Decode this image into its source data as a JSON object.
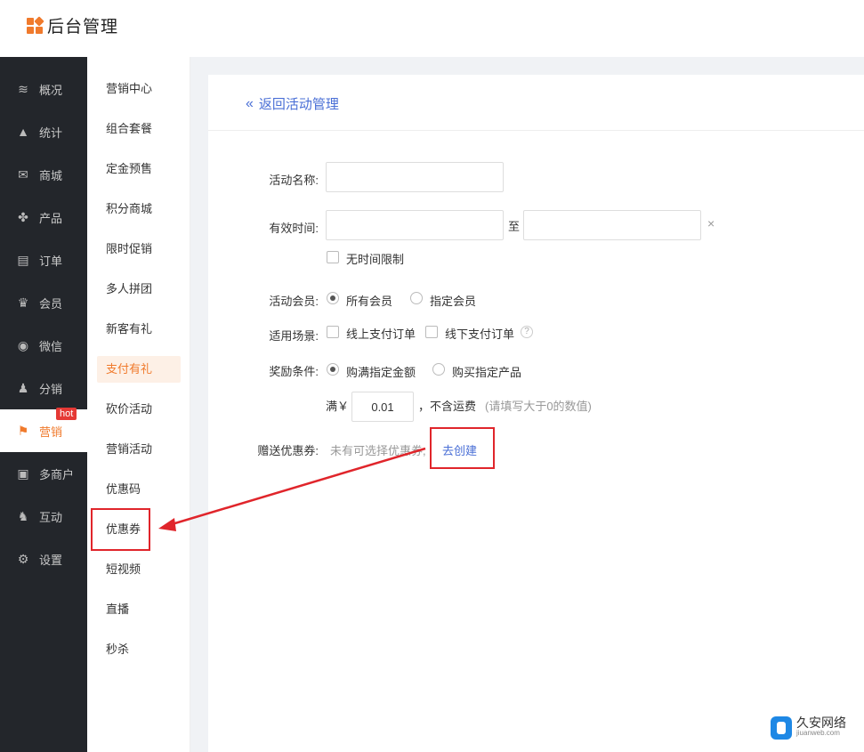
{
  "header": {
    "title": "后台管理"
  },
  "sidebar": {
    "items": [
      {
        "label": "概况",
        "icon": "layers-icon",
        "glyph": "≋"
      },
      {
        "label": "统计",
        "icon": "chart-icon",
        "glyph": "▲"
      },
      {
        "label": "商城",
        "icon": "mail-icon",
        "glyph": "✉"
      },
      {
        "label": "产品",
        "icon": "grid-icon",
        "glyph": "✤"
      },
      {
        "label": "订单",
        "icon": "clipboard-icon",
        "glyph": "▤"
      },
      {
        "label": "会员",
        "icon": "crown-icon",
        "glyph": "♛"
      },
      {
        "label": "微信",
        "icon": "wechat-icon",
        "glyph": "◉"
      },
      {
        "label": "分销",
        "icon": "users-icon",
        "glyph": "♟"
      },
      {
        "label": "营销",
        "icon": "flag-icon",
        "glyph": "⚑",
        "badge": "hot"
      },
      {
        "label": "多商户",
        "icon": "shop-icon",
        "glyph": "▣"
      },
      {
        "label": "互动",
        "icon": "people-icon",
        "glyph": "♞"
      },
      {
        "label": "设置",
        "icon": "gear-icon",
        "glyph": "⚙"
      }
    ]
  },
  "submenu": {
    "items": [
      "营销中心",
      "组合套餐",
      "定金预售",
      "积分商城",
      "限时促销",
      "多人拼团",
      "新客有礼",
      "支付有礼",
      "砍价活动",
      "营销活动",
      "优惠码",
      "优惠券",
      "短视频",
      "直播",
      "秒杀"
    ],
    "active": "支付有礼"
  },
  "main": {
    "back_label": "返回活动管理",
    "form": {
      "name_label": "活动名称:",
      "name_value": "",
      "time_label": "有效时间:",
      "time_sep": "至",
      "time_clear": "×",
      "no_limit_label": "无时间限制",
      "member_label": "活动会员:",
      "member_all": "所有会员",
      "member_specific": "指定会员",
      "scene_label": "适用场景:",
      "scene_online": "线上支付订单",
      "scene_offline": "线下支付订单",
      "scene_help": "?",
      "reward_label": "奖励条件:",
      "reward_amount": "购满指定金额",
      "reward_product": "购买指定产品",
      "full_prefix": "满￥",
      "full_value": "0.01",
      "full_suffix": "，不含运费",
      "full_hint": "(请填写大于0的数值)",
      "coupon_label": "赠送优惠券:",
      "coupon_empty": "未有可选择优惠券,",
      "coupon_create": "去创建"
    }
  },
  "watermark": {
    "cn": "久安网络",
    "en": "jiuanweb.com"
  },
  "colors": {
    "accent": "#f07a2c",
    "link": "#4a6fd6",
    "annotation": "#e0252b",
    "sidebar_bg": "#23262b"
  }
}
